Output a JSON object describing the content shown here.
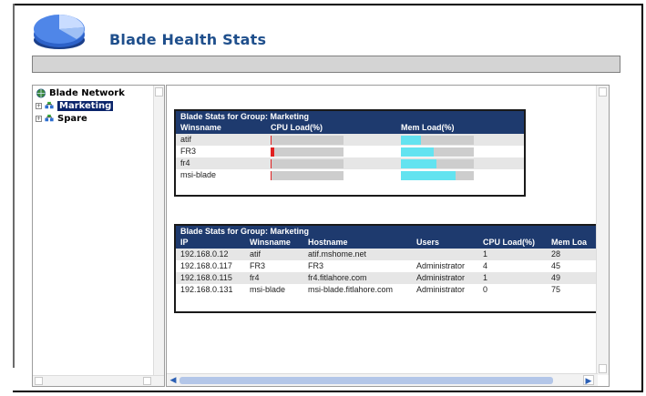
{
  "app": {
    "title": "Blade Health Stats"
  },
  "tree": {
    "root_label": "Blade Network",
    "items": [
      {
        "label": "Marketing",
        "selected": true
      },
      {
        "label": "Spare",
        "selected": false
      }
    ]
  },
  "cpu_mem_table": {
    "title": "Blade Stats for Group: Marketing",
    "headers": {
      "winsname": "Winsname",
      "cpu": "CPU Load(%)",
      "mem": "Mem Load(%)"
    },
    "rows": [
      {
        "winsname": "atif",
        "cpu": 1,
        "mem": 28
      },
      {
        "winsname": "FR3",
        "cpu": 4,
        "mem": 45
      },
      {
        "winsname": "fr4",
        "cpu": 1,
        "mem": 49
      },
      {
        "winsname": "msi-blade",
        "cpu": 0,
        "mem": 75
      }
    ],
    "colors": {
      "cpu_bar": "#e02020",
      "mem_bar": "#63e3f0",
      "bar_bg": "#cdcdcd",
      "header_bg": "#1e3a6e"
    }
  },
  "detail_table": {
    "title": "Blade Stats for Group: Marketing",
    "headers": {
      "ip": "IP",
      "winsname": "Winsname",
      "hostname": "Hostname",
      "users": "Users",
      "cpu": "CPU Load(%)",
      "mem": "Mem Loa"
    },
    "rows": [
      {
        "ip": "192.168.0.12",
        "winsname": "atif",
        "hostname": "atif.mshome.net",
        "users": "",
        "cpu": "1",
        "mem": "28"
      },
      {
        "ip": "192.168.0.117",
        "winsname": "FR3",
        "hostname": "FR3",
        "users": "Administrator",
        "cpu": "4",
        "mem": "45"
      },
      {
        "ip": "192.168.0.115",
        "winsname": "fr4",
        "hostname": "fr4.fitlahore.com",
        "users": "Administrator",
        "cpu": "1",
        "mem": "49"
      },
      {
        "ip": "192.168.0.131",
        "winsname": "msi-blade",
        "hostname": "msi-blade.fitlahore.com",
        "users": "Administrator",
        "cpu": "0",
        "mem": "75"
      }
    ]
  }
}
